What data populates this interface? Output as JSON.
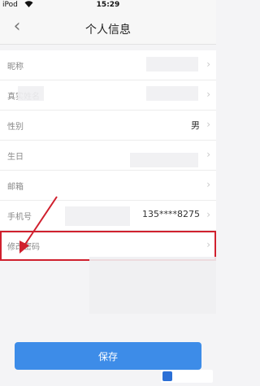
{
  "status_bar": {
    "carrier": "iPod",
    "time": "15:29"
  },
  "nav": {
    "title": "个人信息"
  },
  "rows": [
    {
      "label": "昵称",
      "value": ""
    },
    {
      "label": "真实姓名",
      "value": ""
    },
    {
      "label": "性别",
      "value": "男"
    },
    {
      "label": "生日",
      "value": ""
    },
    {
      "label": "邮箱",
      "value": ""
    },
    {
      "label": "手机号",
      "value": "135****8275"
    },
    {
      "label": "修改密码",
      "value": ""
    }
  ],
  "save_label": "保存",
  "colors": {
    "accent": "#3d8ce8",
    "highlight": "#d0202e"
  },
  "icons": {
    "back": "chevron-left-icon",
    "row_arrow": "chevron-right-icon"
  }
}
